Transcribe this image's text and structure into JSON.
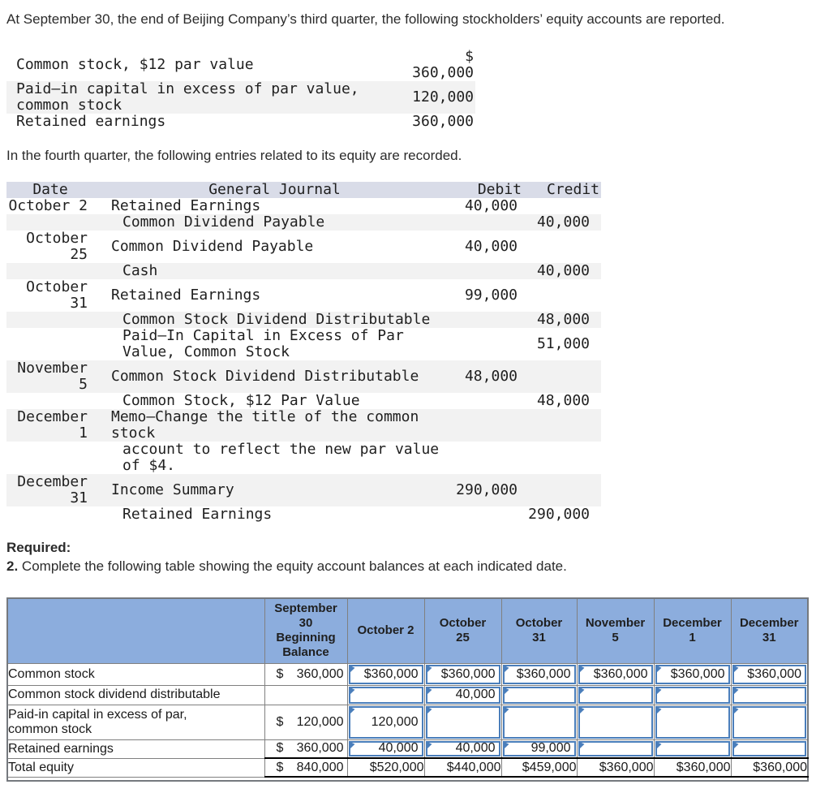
{
  "intro": {
    "paragraph1": "At September 30, the end of Beijing Company’s third quarter, the following stockholders’ equity accounts are reported.",
    "paragraph2": "In the fourth quarter, the following entries related to its equity are recorded."
  },
  "equity_accounts": {
    "rows": [
      {
        "label": "Common stock, $12 par value",
        "value": "$\n360,000"
      },
      {
        "label": "Paid–in capital in excess of par value,\ncommon stock",
        "value": "120,000"
      },
      {
        "label": "Retained earnings",
        "value": "360,000"
      }
    ]
  },
  "journal": {
    "headers": {
      "date": "Date",
      "journal": "General Journal",
      "debit": "Debit",
      "credit": "Credit"
    },
    "rows": [
      {
        "date": "October 2",
        "account": "Retained Earnings",
        "debit": "40,000",
        "credit": "",
        "indent": false
      },
      {
        "date": "",
        "account": "Common Dividend Payable",
        "debit": "",
        "credit": "40,000",
        "indent": true
      },
      {
        "date": "October\n25",
        "account": "Common Dividend Payable",
        "debit": "40,000",
        "credit": "",
        "indent": false
      },
      {
        "date": "",
        "account": "Cash",
        "debit": "",
        "credit": "40,000",
        "indent": true
      },
      {
        "date": "October\n31",
        "account": "Retained Earnings",
        "debit": "99,000",
        "credit": "",
        "indent": false
      },
      {
        "date": "",
        "account": "Common Stock Dividend Distributable",
        "debit": "",
        "credit": "48,000",
        "indent": true
      },
      {
        "date": "",
        "account": "Paid–In Capital in Excess of Par\nValue, Common Stock",
        "debit": "",
        "credit": "51,000",
        "indent": true
      },
      {
        "date": "November\n5",
        "account": "Common Stock Dividend Distributable",
        "debit": "48,000",
        "credit": "",
        "indent": false
      },
      {
        "date": "",
        "account": "Common Stock, $12 Par Value",
        "debit": "",
        "credit": "48,000",
        "indent": true
      },
      {
        "date": "December\n1",
        "account": "Memo–Change the title of the common\nstock",
        "debit": "",
        "credit": "",
        "indent": false
      },
      {
        "date": "",
        "account": "account to reflect the new par value\nof $4.",
        "debit": "",
        "credit": "",
        "indent": true
      },
      {
        "date": "December\n31",
        "account": "Income Summary",
        "debit": "290,000",
        "credit": "",
        "indent": false
      },
      {
        "date": "",
        "account": "Retained Earnings",
        "debit": "",
        "credit": "290,000",
        "indent": true
      }
    ]
  },
  "required": {
    "heading": "Required:",
    "item_number": "2.",
    "item_text": "Complete the following table showing the equity account balances at each indicated date."
  },
  "balance_table": {
    "columns": [
      "September\n30\nBeginning\nBalance",
      "October 2",
      "October\n25",
      "October\n31",
      "November\n5",
      "December\n1",
      "December\n31"
    ],
    "rows": [
      {
        "label": "Common stock",
        "editable": true,
        "beginning": {
          "dollar": "$",
          "amount": "360,000"
        },
        "cells": [
          "$360,000",
          "$360,000",
          "$360,000",
          "$360,000",
          "$360,000",
          "$360,000"
        ]
      },
      {
        "label": "Common stock dividend distributable",
        "editable": true,
        "beginning": {
          "dollar": "",
          "amount": ""
        },
        "cells": [
          "",
          "40,000",
          "",
          "",
          "",
          ""
        ]
      },
      {
        "label": "Paid-in capital in excess of par,\ncommon stock",
        "editable": true,
        "beginning": {
          "dollar": "$",
          "amount": "120,000"
        },
        "cells": [
          "120,000",
          "",
          "",
          "",
          "",
          ""
        ]
      },
      {
        "label": "Retained earnings",
        "editable": true,
        "beginning": {
          "dollar": "$",
          "amount": "360,000"
        },
        "cells": [
          "40,000",
          "40,000",
          "99,000",
          "",
          "",
          ""
        ]
      },
      {
        "label": "Total equity",
        "editable": false,
        "beginning": {
          "dollar": "$",
          "amount": "840,000"
        },
        "cells": [
          "$520,000",
          "$440,000",
          "$459,000",
          "$360,000",
          "$360,000",
          "$360,000"
        ]
      }
    ]
  },
  "colors": {
    "header_blue": "#8caddd",
    "answer_border_blue": "#4a7ebb",
    "journal_header_bg": "#d9dce8",
    "row_stripe": "#f2f2f2"
  }
}
